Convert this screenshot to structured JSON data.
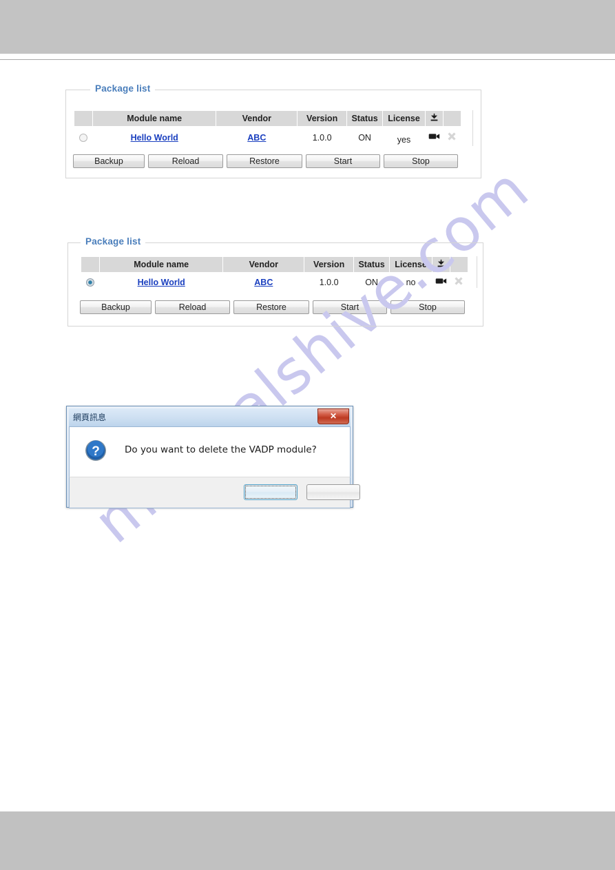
{
  "page": {
    "watermark": "manualshive.com"
  },
  "panels": [
    {
      "legend": "Package list",
      "table": {
        "headers": [
          "",
          "Module name",
          "Vendor",
          "Version",
          "Status",
          "License",
          "download-icon",
          ""
        ],
        "rows": [
          {
            "selected": false,
            "module_name": "Hello World",
            "vendor": "ABC",
            "version": "1.0.0",
            "status": "ON",
            "license": "yes",
            "camera_icon": "camera-icon",
            "delete_icon": "delete-icon"
          }
        ]
      },
      "buttons": [
        "Backup",
        "Reload",
        "Restore",
        "Start",
        "Stop"
      ]
    },
    {
      "legend": "Package list",
      "table": {
        "headers": [
          "",
          "Module name",
          "Vendor",
          "Version",
          "Status",
          "License",
          "download-icon",
          ""
        ],
        "rows": [
          {
            "selected": true,
            "module_name": "Hello World",
            "vendor": "ABC",
            "version": "1.0.0",
            "status": "ON",
            "license": "no",
            "camera_icon": "camera-icon",
            "delete_icon": "delete-icon"
          }
        ]
      },
      "buttons": [
        "Backup",
        "Reload",
        "Restore",
        "Start",
        "Stop"
      ]
    }
  ],
  "dialog": {
    "title": "網頁訊息",
    "close_label": "✕",
    "icon": "question-icon",
    "message": "Do you want to delete the VADP module?",
    "default_button": "",
    "secondary_button": ""
  }
}
